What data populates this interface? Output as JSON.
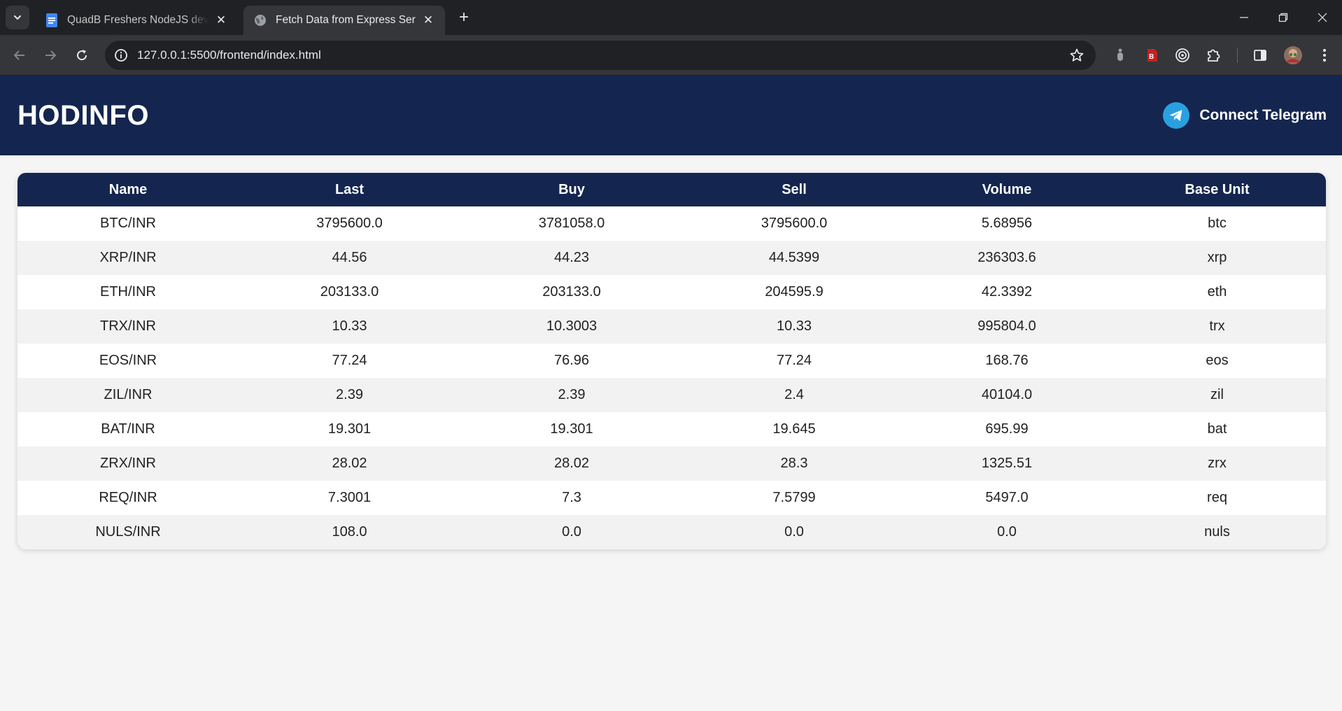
{
  "browser": {
    "tabs": [
      {
        "title": "QuadB Freshers NodeJS develop",
        "icon": "docs-icon",
        "active": false
      },
      {
        "title": "Fetch Data from Express Server",
        "icon": "globe-icon",
        "active": true
      }
    ],
    "url": "127.0.0.1:5500/frontend/index.html"
  },
  "header": {
    "brand": "HODINFO",
    "telegram_label": "Connect Telegram"
  },
  "table": {
    "columns": [
      "Name",
      "Last",
      "Buy",
      "Sell",
      "Volume",
      "Base Unit"
    ],
    "rows": [
      [
        "BTC/INR",
        "3795600.0",
        "3781058.0",
        "3795600.0",
        "5.68956",
        "btc"
      ],
      [
        "XRP/INR",
        "44.56",
        "44.23",
        "44.5399",
        "236303.6",
        "xrp"
      ],
      [
        "ETH/INR",
        "203133.0",
        "203133.0",
        "204595.9",
        "42.3392",
        "eth"
      ],
      [
        "TRX/INR",
        "10.33",
        "10.3003",
        "10.33",
        "995804.0",
        "trx"
      ],
      [
        "EOS/INR",
        "77.24",
        "76.96",
        "77.24",
        "168.76",
        "eos"
      ],
      [
        "ZIL/INR",
        "2.39",
        "2.39",
        "2.4",
        "40104.0",
        "zil"
      ],
      [
        "BAT/INR",
        "19.301",
        "19.301",
        "19.645",
        "695.99",
        "bat"
      ],
      [
        "ZRX/INR",
        "28.02",
        "28.02",
        "28.3",
        "1325.51",
        "zrx"
      ],
      [
        "REQ/INR",
        "7.3001",
        "7.3",
        "7.5799",
        "5497.0",
        "req"
      ],
      [
        "NULS/INR",
        "108.0",
        "0.0",
        "0.0",
        "0.0",
        "nuls"
      ]
    ]
  },
  "colors": {
    "header_bg": "#14264f",
    "telegram_blue": "#2aa0e0",
    "row_alt": "#f2f2f2"
  }
}
